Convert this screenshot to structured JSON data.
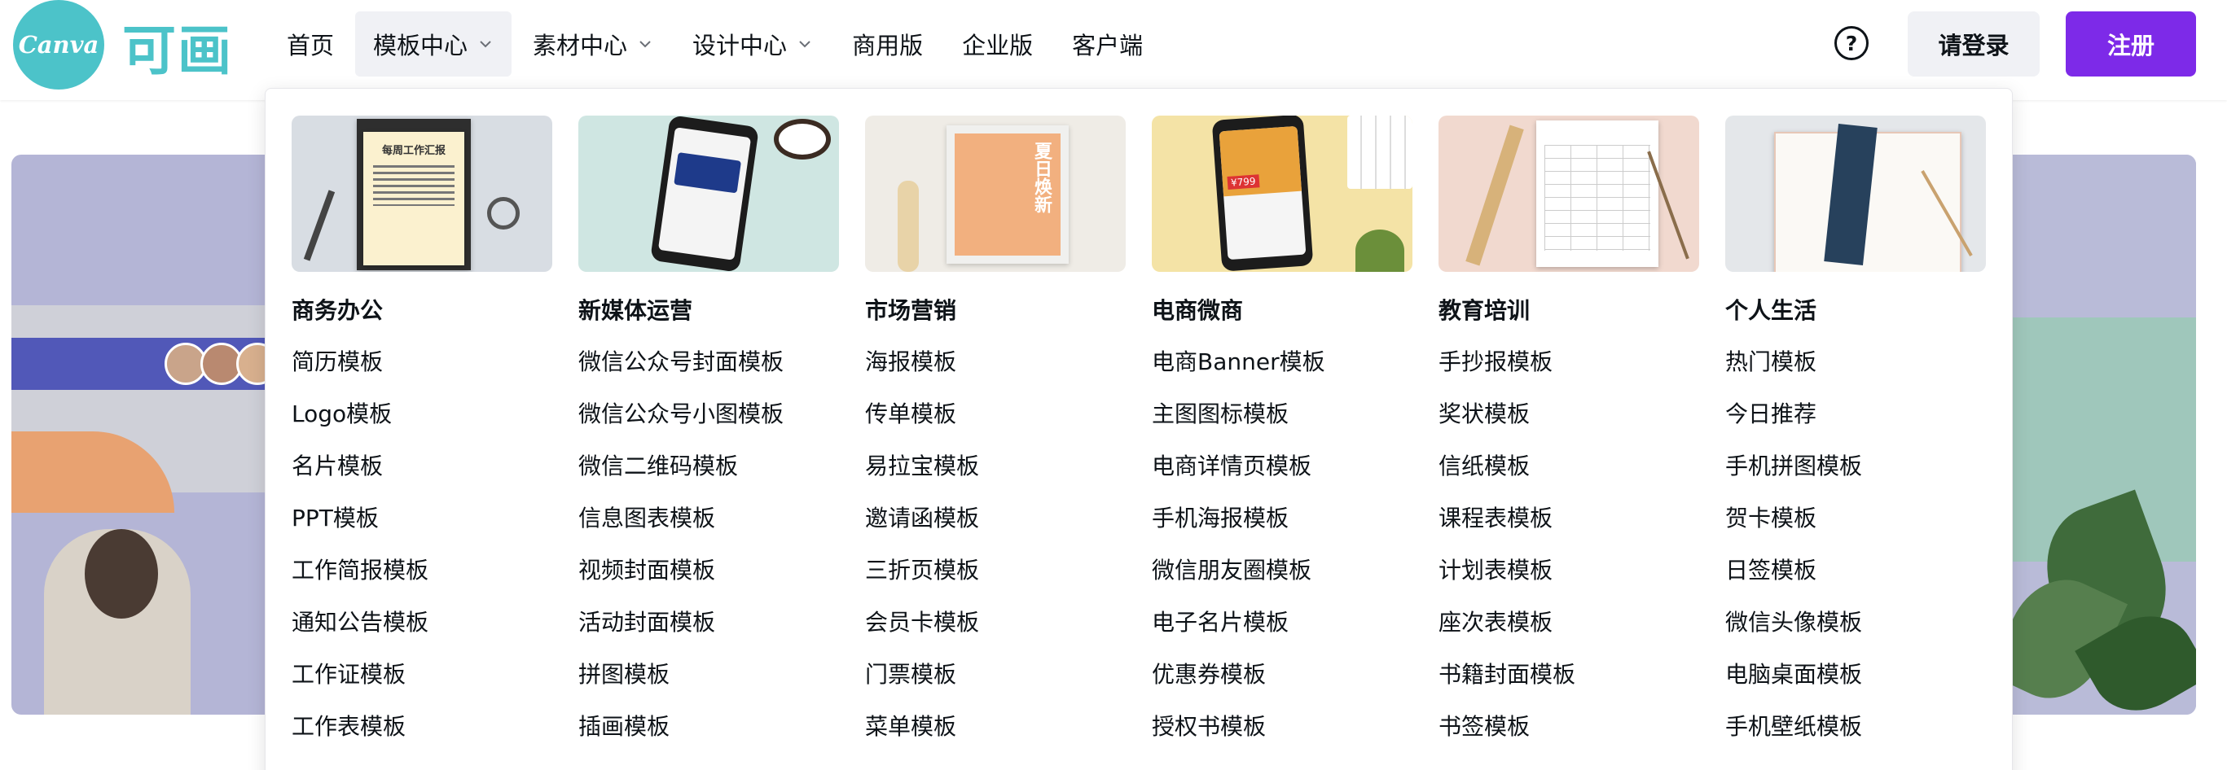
{
  "brand": {
    "logo_text": "Canva",
    "logo_cn": "可画",
    "accent_teal": "#4cc3c9",
    "accent_purple": "#7d2ae8"
  },
  "nav": {
    "items": [
      {
        "label": "首页"
      },
      {
        "label": "模板中心"
      },
      {
        "label": "素材中心"
      },
      {
        "label": "设计中心"
      },
      {
        "label": "商用版"
      },
      {
        "label": "企业版"
      },
      {
        "label": "客户端"
      }
    ]
  },
  "header_actions": {
    "help_icon": "question-circle-icon",
    "help_glyph": "?",
    "login_label": "请登录",
    "register_label": "注册"
  },
  "menu": {
    "columns": [
      {
        "title": "商务办公",
        "items": [
          "简历模板",
          "Logo模板",
          "名片模板",
          "PPT模板",
          "工作简报模板",
          "通知公告模板",
          "工作证模板",
          "工作表模板"
        ]
      },
      {
        "title": "新媒体运营",
        "items": [
          "微信公众号封面模板",
          "微信公众号小图模板",
          "微信二维码模板",
          "信息图表模板",
          "视频封面模板",
          "活动封面模板",
          "拼图模板",
          "插画模板"
        ]
      },
      {
        "title": "市场营销",
        "items": [
          "海报模板",
          "传单模板",
          "易拉宝模板",
          "邀请函模板",
          "三折页模板",
          "会员卡模板",
          "门票模板",
          "菜单模板"
        ]
      },
      {
        "title": "电商微商",
        "items": [
          "电商Banner模板",
          "主图图标模板",
          "电商详情页模板",
          "手机海报模板",
          "微信朋友圈模板",
          "电子名片模板",
          "优惠券模板",
          "授权书模板"
        ]
      },
      {
        "title": "教育培训",
        "items": [
          "手抄报模板",
          "奖状模板",
          "信纸模板",
          "课程表模板",
          "计划表模板",
          "座次表模板",
          "书籍封面模板",
          "书签模板"
        ]
      },
      {
        "title": "个人生活",
        "items": [
          "热门模板",
          "今日推荐",
          "手机拼图模板",
          "贺卡模板",
          "日签模板",
          "微信头像模板",
          "电脑桌面模板",
          "手机壁纸模板"
        ]
      }
    ]
  },
  "thumbnails": {
    "doc_title": "每周工作汇报",
    "poster_text": "夏日焕新",
    "price_text": "¥799"
  }
}
